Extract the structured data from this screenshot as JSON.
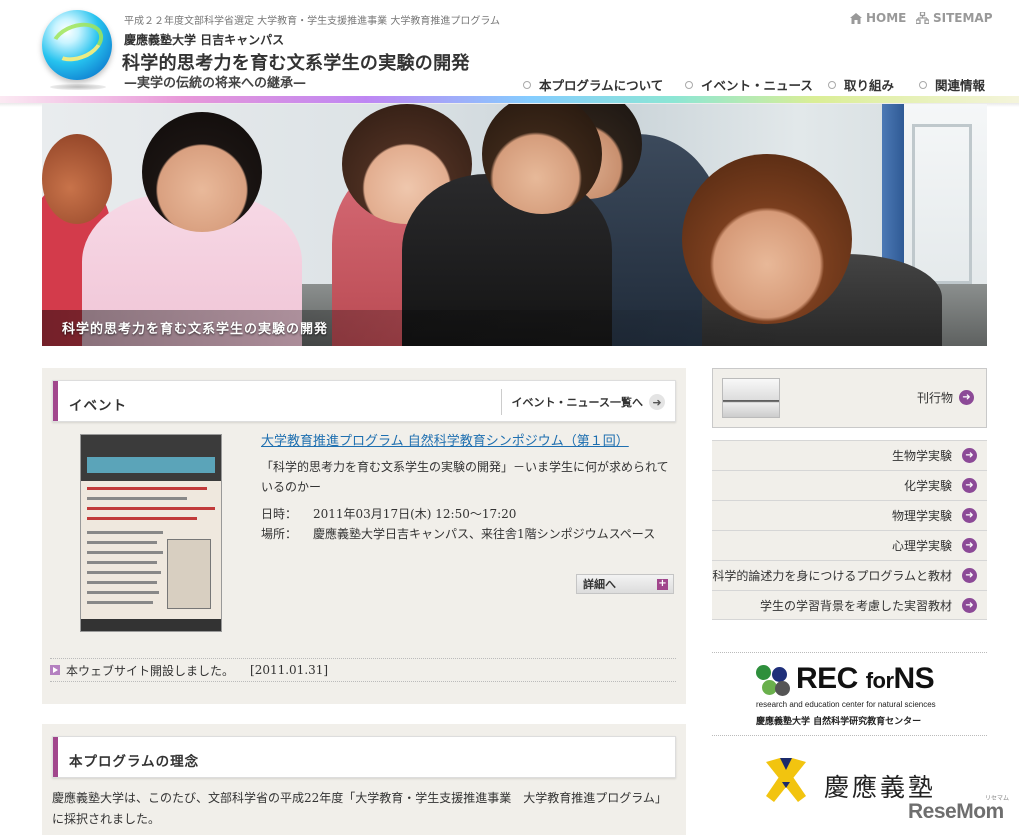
{
  "header": {
    "subtitle": "平成２２年度文部科学省選定 大学教育・学生支援推進事業 大学教育推進プログラム",
    "campus": "慶應義塾大学 日吉キャンパス",
    "title": "科学的思考力を育む文系学生の実験の開発",
    "tagline": "—実学の伝統の将来への継承—",
    "home_label": "HOME",
    "sitemap_label": "SITEMAP"
  },
  "global_nav": [
    {
      "label": "本プログラムについて"
    },
    {
      "label": "イベント・ニュース"
    },
    {
      "label": "取り組み"
    },
    {
      "label": "関連情報"
    }
  ],
  "hero": {
    "caption": "科学的思考力を育む文系学生の実験の開発"
  },
  "events": {
    "heading": "イベント",
    "more_label": "イベント・ニュース一覧へ",
    "item": {
      "title": "大学教育推進プログラム 自然科学教育シンポジウム（第１回）",
      "description": "「科学的思考力を育む文系学生の実験の開発」－いま学生に何が求められているのかー",
      "datetime_key": "日時：",
      "datetime_value": "2011年03月17日(木) 12:50～17:20",
      "place_key": "場所：",
      "place_value": "慶應義塾大学日吉キャンパス、来往舎1階シンポジウムスペース",
      "detail_label": "詳細へ"
    },
    "news": {
      "text": "本ウェブサイト開設しました。",
      "date": "[2011.01.31]"
    }
  },
  "philosophy": {
    "heading": "本プログラムの理念",
    "text": "慶應義塾大学は、このたび、文部科学省の平成22年度「大学教育・学生支援推進事業　大学教育推進プログラム」に採択されました。"
  },
  "sidebar": {
    "publications_label": "刊行物",
    "menu": [
      {
        "label": "生物学実験"
      },
      {
        "label": "化学実験"
      },
      {
        "label": "物理学実験"
      },
      {
        "label": "心理学実験"
      },
      {
        "label": "科学的論述力を身につけるプログラムと教材"
      },
      {
        "label": "学生の学習背景を考慮した実習教材"
      }
    ],
    "rec": {
      "logo_main": "REC",
      "logo_for": "for",
      "logo_ns": "NS",
      "line1": "research and education center for natural sciences",
      "line2": "慶應義塾大学 自然科学研究教育センター"
    },
    "keio": {
      "name": "慶應義塾"
    }
  },
  "watermark": {
    "text": "ReseMom",
    "small": "リセマム"
  },
  "colors": {
    "accent_purple": "#a1468c",
    "arrow_purple": "#8c4a97",
    "link_blue": "#1e6fb0",
    "panel_bg": "#f1efea"
  },
  "icons": {
    "home": "home-icon",
    "sitemap": "sitemap-icon",
    "nav_dot": "circle-bullet-icon",
    "arrow": "arrow-right-circle-icon"
  }
}
